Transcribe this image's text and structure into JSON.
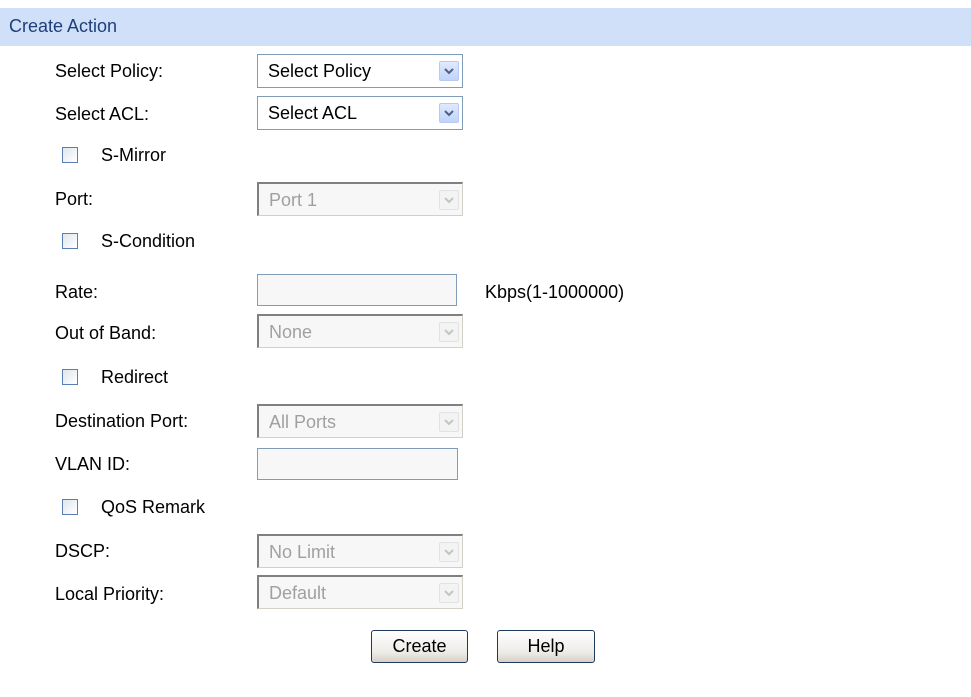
{
  "title": "Create Action",
  "fields": {
    "select_policy": {
      "label": "Select Policy:",
      "value": "Select Policy"
    },
    "select_acl": {
      "label": "Select ACL:",
      "value": "Select ACL"
    },
    "s_mirror": {
      "label": "S-Mirror",
      "checked": false
    },
    "port": {
      "label": "Port:",
      "value": "Port 1"
    },
    "s_condition": {
      "label": "S-Condition",
      "checked": false
    },
    "rate": {
      "label": "Rate:",
      "value": "",
      "unit": "Kbps(1-1000000)"
    },
    "out_of_band": {
      "label": "Out of Band:",
      "value": "None"
    },
    "redirect": {
      "label": "Redirect",
      "checked": false
    },
    "destination_port": {
      "label": "Destination Port:",
      "value": "All Ports"
    },
    "vlan_id": {
      "label": "VLAN ID:",
      "value": ""
    },
    "qos_remark": {
      "label": "QoS Remark",
      "checked": false
    },
    "dscp": {
      "label": "DSCP:",
      "value": "No Limit"
    },
    "local_priority": {
      "label": "Local Priority:",
      "value": "Default"
    }
  },
  "buttons": {
    "create": "Create",
    "help": "Help"
  },
  "colors": {
    "header_bg": "#cfe0f8",
    "header_text": "#1f3f7a",
    "field_border": "#7f9db9",
    "disabled_text": "#a0a0a0"
  },
  "icons": {
    "dropdown": "chevron-down-icon",
    "checkbox": "checkbox-icon"
  }
}
